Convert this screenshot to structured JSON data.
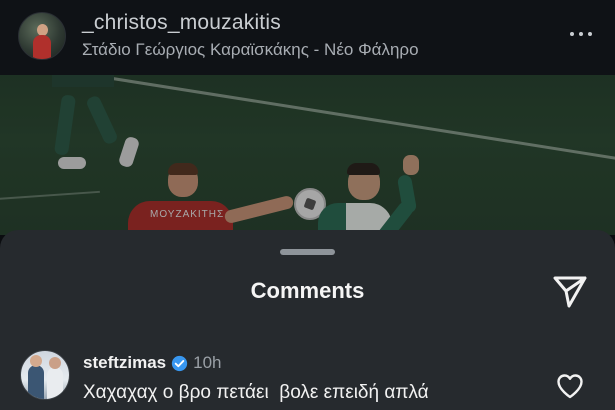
{
  "post": {
    "username": "_christos_mouzakitis",
    "location": "Στάδιο Γεώργιος Καραϊσκάκης - Νέο Φάληρο",
    "more_icon": "more-horizontal-icon"
  },
  "media": {
    "player_name_jersey": "ΜΟΥΖΑΚΙΤΗΣ"
  },
  "comments_sheet": {
    "title": "Comments",
    "share_icon": "send-icon"
  },
  "comments": [
    {
      "username": "steftzimas",
      "verified": true,
      "time": "10h",
      "text": "Χαχαχαχ ο βρο πετάει  βολε επειδή απλά",
      "like_icon": "heart-icon"
    }
  ],
  "colors": {
    "sheet_bg": "#262a2e",
    "header_bg": "#0f1216",
    "verified": "#3897f0"
  }
}
